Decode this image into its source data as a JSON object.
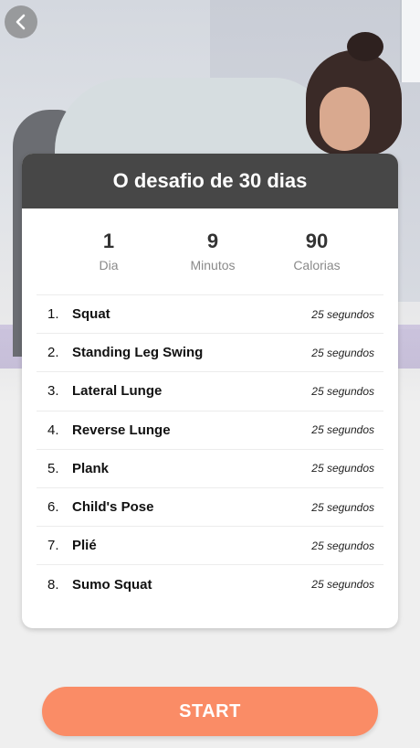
{
  "header": {
    "title": "O desafio de 30 dias"
  },
  "stats": [
    {
      "value": "1",
      "label": "Dia"
    },
    {
      "value": "9",
      "label": "Minutos"
    },
    {
      "value": "90",
      "label": "Calorias"
    }
  ],
  "exercises": [
    {
      "num": "1.",
      "name": "Squat",
      "duration": "25 segundos"
    },
    {
      "num": "2.",
      "name": "Standing Leg Swing",
      "duration": "25 segundos"
    },
    {
      "num": "3.",
      "name": "Lateral Lunge",
      "duration": "25 segundos"
    },
    {
      "num": "4.",
      "name": "Reverse Lunge",
      "duration": "25 segundos"
    },
    {
      "num": "5.",
      "name": "Plank",
      "duration": "25 segundos"
    },
    {
      "num": "6.",
      "name": "Child's Pose",
      "duration": "25 segundos"
    },
    {
      "num": "7.",
      "name": "Plié",
      "duration": "25 segundos"
    },
    {
      "num": "8.",
      "name": "Sumo Squat",
      "duration": "25 segundos"
    }
  ],
  "start_button": {
    "label": "START"
  },
  "icons": {
    "back": "chevron-left-icon"
  },
  "colors": {
    "accent": "#fa8c66",
    "header_bg": "#474747"
  }
}
